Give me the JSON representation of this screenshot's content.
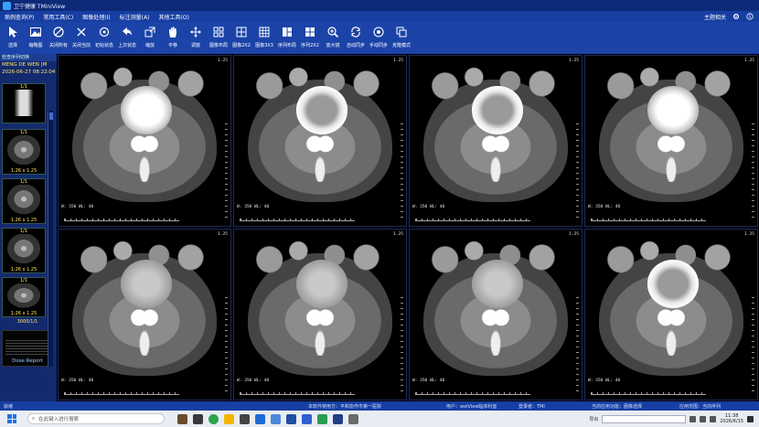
{
  "window": {
    "title": "卫宁健康 TMiniView"
  },
  "menu": {
    "items": [
      "病例查询(P)",
      "常用工具(C)",
      "图像处理(I)",
      "标注测量(A)",
      "其他工具(O)"
    ],
    "right_label": "主题相关"
  },
  "toolbar": {
    "tools": [
      {
        "label": "选择",
        "icon": "pointer-icon"
      },
      {
        "label": "缩略图",
        "icon": "image-icon"
      },
      {
        "label": "关闭所有",
        "icon": "ban-icon"
      },
      {
        "label": "关闭当前",
        "icon": "close-icon"
      },
      {
        "label": "初始状态",
        "icon": "reset-icon"
      },
      {
        "label": "上次状态",
        "icon": "undo-icon"
      },
      {
        "label": "缩放",
        "icon": "zoom-box-icon"
      },
      {
        "label": "平移",
        "icon": "hand-icon"
      },
      {
        "label": "调窗",
        "icon": "move-arrows-icon"
      },
      {
        "label": "图像布局",
        "icon": "grid-icon"
      },
      {
        "label": "图像2X2",
        "icon": "grid-2x2-icon"
      },
      {
        "label": "图像3X3",
        "icon": "grid-3x3-icon"
      },
      {
        "label": "序列布局",
        "icon": "series-layout-icon"
      },
      {
        "label": "序列2X2",
        "icon": "series-2x2-icon"
      },
      {
        "label": "放大镜",
        "icon": "magnifier-icon"
      },
      {
        "label": "自动同步",
        "icon": "sync-icon"
      },
      {
        "label": "手动同步",
        "icon": "target-icon"
      },
      {
        "label": "克隆模式",
        "icon": "clone-icon"
      }
    ]
  },
  "left_panel": {
    "title": "检查序列切换",
    "patient_name": "MENG DE WEN [M",
    "study_datetime": "2026-06-27 08:22:04",
    "thumbnails": [
      {
        "number": "1/1",
        "scale": ""
      },
      {
        "number": "1/1",
        "scale": "1:26 x 1.25"
      },
      {
        "number": "1/1",
        "scale": "1:26 x 1.25"
      },
      {
        "number": "1/1",
        "scale": "1:26 x 1.25"
      },
      {
        "number": "1/1",
        "scale": "1:26 x 1.25"
      }
    ],
    "series_id": "3000/1/1",
    "dose_report_label": "Dose Report"
  },
  "viewer": {
    "panes": [
      {
        "mass": "bright",
        "info": "W: 350 WL: 40",
        "zoom": "1.25"
      },
      {
        "mass": "ring",
        "info": "W: 350 WL: 40",
        "zoom": "1.25"
      },
      {
        "mass": "ring",
        "info": "W: 350 WL: 40",
        "zoom": "1.25"
      },
      {
        "mass": "bright",
        "info": "W: 350 WL: 40",
        "zoom": "1.25"
      },
      {
        "mass": "dim",
        "info": "W: 350 WL: 40",
        "zoom": "1.25"
      },
      {
        "mass": "dim",
        "info": "W: 350 WL: 40",
        "zoom": "1.25"
      },
      {
        "mass": "dim",
        "info": "W: 350 WL: 40",
        "zoom": "1.25"
      },
      {
        "mass": "ring",
        "info": "W: 350 WL: 40",
        "zoom": "1.25"
      }
    ]
  },
  "status": {
    "left": "就绪",
    "unit": "本软件使用方：平和协作市第一医院",
    "user": "用户：weiView临床科室",
    "login": "登录者：TMI",
    "mode": "当前应用功能：图像选择",
    "scope": "应用范围：当前序列"
  },
  "taskbar": {
    "search_placeholder": "在此键入进行搜索",
    "tray_field_label": "导出",
    "time": "11:38",
    "date": "2026/6/15"
  },
  "colors": {
    "title_bar": "#0d2a78",
    "menu_bar": "#173ea3",
    "toolbar": "#1b43a8",
    "overlay_text": "#ffe46a"
  }
}
